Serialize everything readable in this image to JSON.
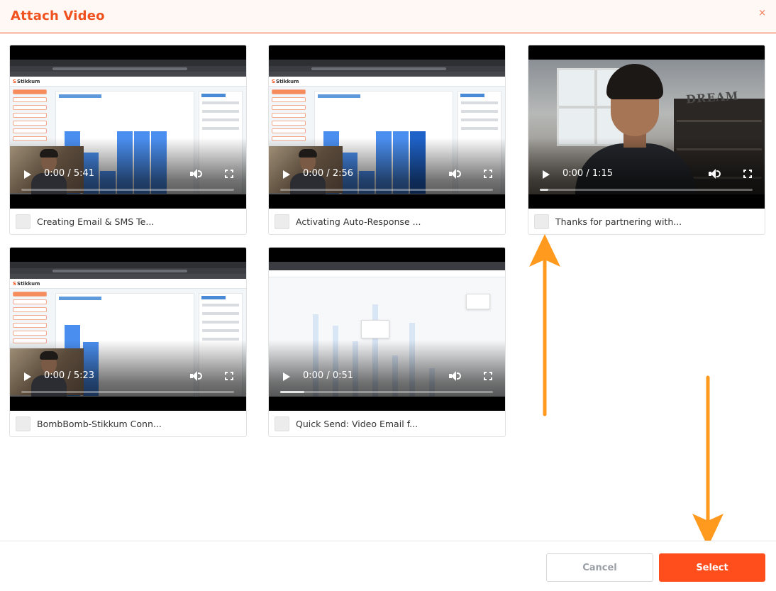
{
  "header": {
    "title": "Attach Video",
    "close_label": "×"
  },
  "videos": [
    {
      "title": "Creating Email & SMS Te...",
      "time": "0:00 / 5:41",
      "progress": 0.0
    },
    {
      "title": "Activating Auto-Response ...",
      "time": "0:00 / 2:56",
      "progress": 0.0
    },
    {
      "title": "Thanks for partnering with...",
      "time": "0:00 / 1:15",
      "progress": 0.0
    },
    {
      "title": "BombBomb-Stikkum Conn...",
      "time": "0:00 / 5:23",
      "progress": 0.0
    },
    {
      "title": "Quick Send: Video Email f...",
      "time": "0:00 / 0:51",
      "progress": 0.0
    }
  ],
  "thumb_text": {
    "logo": "Stikkum",
    "dream": "DREAM"
  },
  "footer": {
    "cancel_label": "Cancel",
    "select_label": "Select"
  },
  "colors": {
    "accent": "#f0521f",
    "select_button": "#ff4d1c",
    "annotation_arrow": "#ff9a1f"
  },
  "icons": {
    "play": "play-icon",
    "volume": "volume-icon",
    "fullscreen": "fullscreen-icon",
    "close": "close-icon"
  }
}
